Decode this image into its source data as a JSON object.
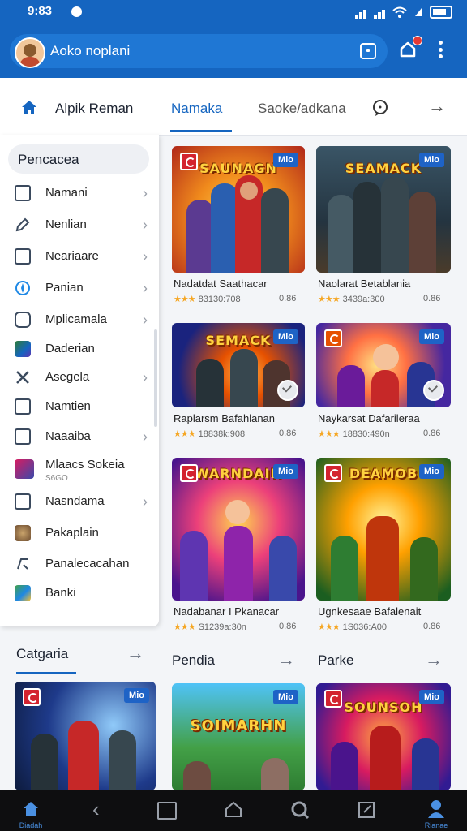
{
  "status": {
    "time": "9:83"
  },
  "appbar": {
    "search_text": "Aoko noplani"
  },
  "tabs": [
    {
      "label": "Alpik Reman"
    },
    {
      "label": "Namaka"
    },
    {
      "label": "Saoke/adkana"
    }
  ],
  "sidebar": {
    "header": "Pencacea",
    "items": [
      {
        "label": "Namani",
        "sub": ""
      },
      {
        "label": "Nenlian",
        "sub": ""
      },
      {
        "label": "Neariaare",
        "sub": ""
      },
      {
        "label": "Panian",
        "sub": ""
      },
      {
        "label": "Mplicamala",
        "sub": ""
      },
      {
        "label": "Daderian",
        "sub": ""
      },
      {
        "label": "Asegela",
        "sub": ""
      },
      {
        "label": "Namtien",
        "sub": ""
      },
      {
        "label": "Naaaiba",
        "sub": ""
      },
      {
        "label": "Mlaacs Sokeia",
        "sub": "S6GO"
      },
      {
        "label": "Nasndama",
        "sub": ""
      },
      {
        "label": "Pakaplain",
        "sub": ""
      },
      {
        "label": "Panalecacahan",
        "sub": ""
      },
      {
        "label": "Banki",
        "sub": ""
      }
    ]
  },
  "cards": [
    {
      "art": "SAUNAGN",
      "badge": "Mio",
      "name": "Nadatdat Saathacar",
      "meta": "83130:708",
      "size": "0.86"
    },
    {
      "art": "SEAMACK",
      "badge": "Mio",
      "name": "Naolarat Betablania",
      "meta": "3439a:300",
      "size": "0.86"
    },
    {
      "art": "SEMACK",
      "badge": "Mio",
      "name": "Raplarsm Bafahlanan",
      "meta": "18838k:908",
      "size": "0.86"
    },
    {
      "art": "",
      "badge": "Mio",
      "name": "Naykarsat Dafarileraa",
      "meta": "18830:490n",
      "size": "0.86"
    },
    {
      "art": "WARNDAIN",
      "badge": "Mio",
      "name": "Nadabanar I Pkanacar",
      "meta": "S1239a:30n",
      "size": "0.86"
    },
    {
      "art": "DEAMOB",
      "badge": "Mio",
      "name": "Ugnkesaae Bafalenait",
      "meta": "1S036:A00",
      "size": "0.86"
    }
  ],
  "sections": [
    {
      "title": "Catgaria"
    },
    {
      "title": "Pendia"
    },
    {
      "title": "Parke"
    }
  ],
  "bottom_cards": [
    {
      "art": "",
      "badge": "Mio"
    },
    {
      "art": "SOIMARHN",
      "badge": "Mio"
    },
    {
      "art": "SOUNSOH",
      "badge": "Mio"
    }
  ],
  "bottomnav": {
    "home_label": "Diadah",
    "profile_label": "Rianae"
  },
  "colors": {
    "primary": "#1565c0",
    "star": "#f5a623",
    "badge": "#1e63c6"
  }
}
